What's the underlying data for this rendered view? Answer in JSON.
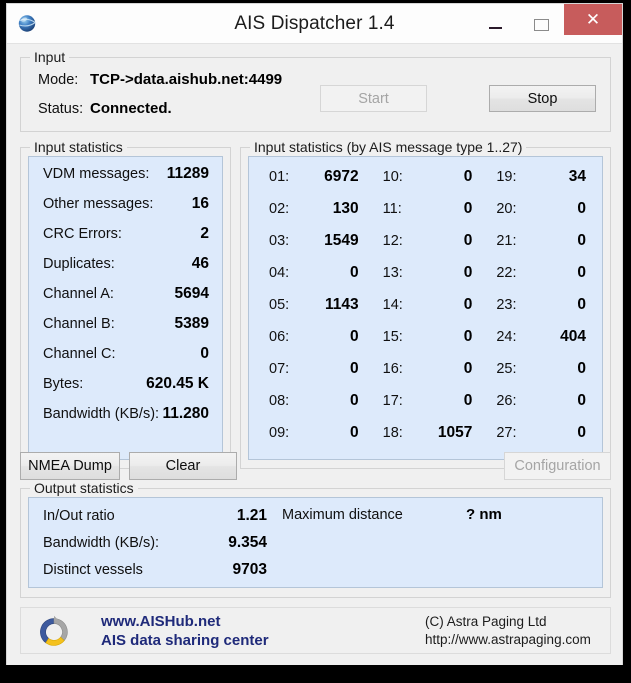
{
  "window": {
    "title": "AIS Dispatcher 1.4",
    "app_icon": "globe-icon",
    "minimize_glyph": "—",
    "maximize_glyph": "",
    "close_glyph": "✕"
  },
  "input": {
    "group_label": "Input",
    "mode_label": "Mode:",
    "mode_value": "TCP->data.aishub.net:4499",
    "status_label": "Status:",
    "status_value": "Connected.",
    "start_label": "Start",
    "stop_label": "Stop"
  },
  "input_statistics": {
    "group_label": "Input statistics",
    "rows": [
      {
        "name": "VDM messages:",
        "value": "11289"
      },
      {
        "name": "Other messages:",
        "value": "16"
      },
      {
        "name": "CRC Errors:",
        "value": "2"
      },
      {
        "name": "Duplicates:",
        "value": "46"
      },
      {
        "name": "Channel A:",
        "value": "5694"
      },
      {
        "name": "Channel B:",
        "value": "5389"
      },
      {
        "name": "Channel C:",
        "value": "0"
      },
      {
        "name": "Bytes:",
        "value": "620.45 K"
      },
      {
        "name": "Bandwidth (KB/s):",
        "value": "11.280"
      }
    ]
  },
  "message_types": {
    "group_label": "Input statistics (by AIS message type 1..27)",
    "cells": [
      {
        "type": "01:",
        "count": "6972"
      },
      {
        "type": "10:",
        "count": "0"
      },
      {
        "type": "19:",
        "count": "34"
      },
      {
        "type": "02:",
        "count": "130"
      },
      {
        "type": "11:",
        "count": "0"
      },
      {
        "type": "20:",
        "count": "0"
      },
      {
        "type": "03:",
        "count": "1549"
      },
      {
        "type": "12:",
        "count": "0"
      },
      {
        "type": "21:",
        "count": "0"
      },
      {
        "type": "04:",
        "count": "0"
      },
      {
        "type": "13:",
        "count": "0"
      },
      {
        "type": "22:",
        "count": "0"
      },
      {
        "type": "05:",
        "count": "1143"
      },
      {
        "type": "14:",
        "count": "0"
      },
      {
        "type": "23:",
        "count": "0"
      },
      {
        "type": "06:",
        "count": "0"
      },
      {
        "type": "15:",
        "count": "0"
      },
      {
        "type": "24:",
        "count": "404"
      },
      {
        "type": "07:",
        "count": "0"
      },
      {
        "type": "16:",
        "count": "0"
      },
      {
        "type": "25:",
        "count": "0"
      },
      {
        "type": "08:",
        "count": "0"
      },
      {
        "type": "17:",
        "count": "0"
      },
      {
        "type": "26:",
        "count": "0"
      },
      {
        "type": "09:",
        "count": "0"
      },
      {
        "type": "18:",
        "count": "1057"
      },
      {
        "type": "27:",
        "count": "0"
      }
    ]
  },
  "actions": {
    "nmea_dump_label": "NMEA Dump",
    "clear_label": "Clear",
    "configuration_label": "Configuration"
  },
  "output_statistics": {
    "group_label": "Output statistics",
    "rows": [
      {
        "name": "In/Out ratio",
        "value": "1.21"
      },
      {
        "name": "Bandwidth (KB/s):",
        "value": "9.354"
      },
      {
        "name": "Distinct vessels",
        "value": "9703"
      }
    ],
    "max_distance_label": "Maximum distance",
    "max_distance_value": "? nm"
  },
  "footer": {
    "logo": "aishub-recycle-logo",
    "brand_line1": "www.AISHub.net",
    "brand_line2": "AIS data sharing center",
    "copyright_line1": "(C) Astra Paging Ltd",
    "copyright_line2": "http://www.astrapaging.com"
  },
  "colors": {
    "panel_background": "#ddeafb",
    "brand_blue": "#1f2a7a",
    "close_button_red": "#c75c5c",
    "window_background": "#f0f0f0"
  }
}
